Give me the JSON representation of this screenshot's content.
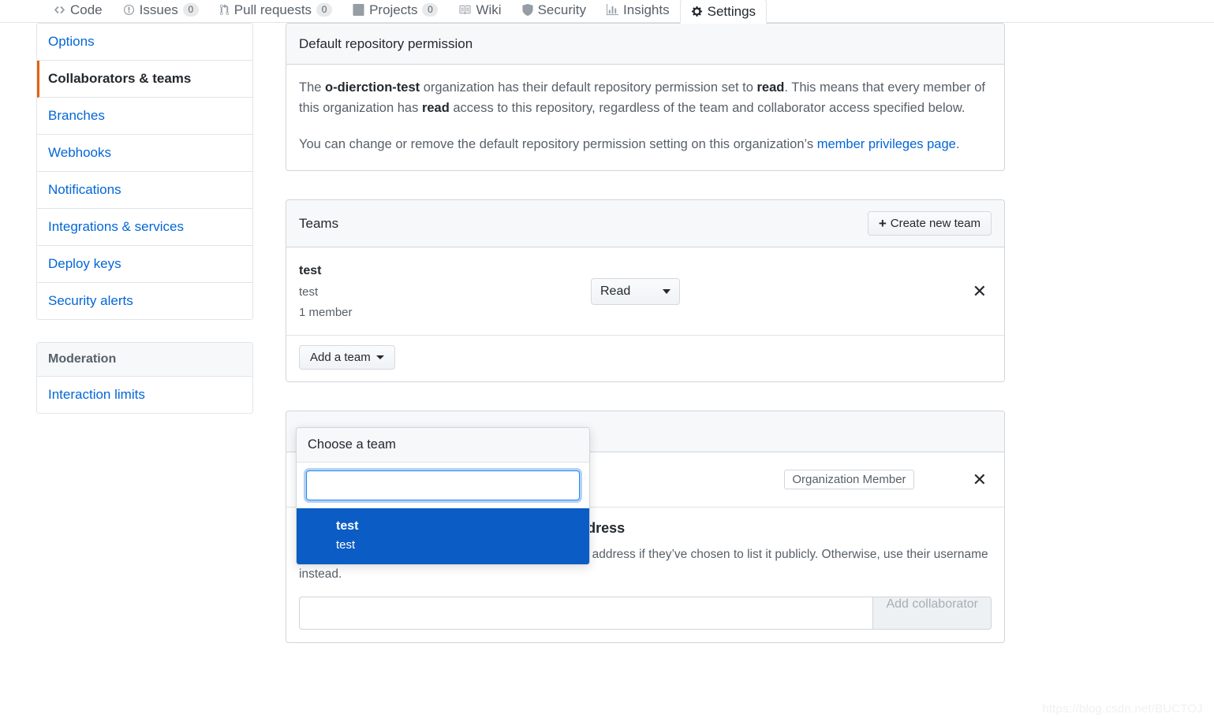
{
  "repo_nav": {
    "items": [
      {
        "label": "Code",
        "icon": "code-icon",
        "count": null,
        "active": false
      },
      {
        "label": "Issues",
        "icon": "issue-opened-icon",
        "count": "0",
        "active": false
      },
      {
        "label": "Pull requests",
        "icon": "git-pull-request-icon",
        "count": "0",
        "active": false
      },
      {
        "label": "Projects",
        "icon": "project-icon",
        "count": "0",
        "active": false
      },
      {
        "label": "Wiki",
        "icon": "book-icon",
        "count": null,
        "active": false
      },
      {
        "label": "Security",
        "icon": "shield-icon",
        "count": null,
        "active": false
      },
      {
        "label": "Insights",
        "icon": "graph-icon",
        "count": null,
        "active": false
      },
      {
        "label": "Settings",
        "icon": "gear-icon",
        "count": null,
        "active": true
      }
    ]
  },
  "sidebar": {
    "items": [
      {
        "label": "Options",
        "selected": false
      },
      {
        "label": "Collaborators & teams",
        "selected": true
      },
      {
        "label": "Branches",
        "selected": false
      },
      {
        "label": "Webhooks",
        "selected": false
      },
      {
        "label": "Notifications",
        "selected": false
      },
      {
        "label": "Integrations & services",
        "selected": false
      },
      {
        "label": "Deploy keys",
        "selected": false
      },
      {
        "label": "Security alerts",
        "selected": false
      }
    ],
    "moderation": {
      "heading": "Moderation",
      "items": [
        {
          "label": "Interaction limits",
          "selected": false
        }
      ]
    }
  },
  "default_permission": {
    "title": "Default repository permission",
    "p1_a": "The ",
    "p1_org": "o-dierction-test",
    "p1_b": " organization has their default repository permission set to ",
    "p1_perm": "read",
    "p1_c": ". This means that every member of this organization has ",
    "p1_perm2": "read",
    "p1_d": " access to this repository, regardless of the team and collaborator access specified below.",
    "p2_a": "You can change or remove the default repository permission setting on this organization’s ",
    "p2_link": "member privileges page",
    "p2_b": "."
  },
  "teams": {
    "title": "Teams",
    "create_button": "Create new team",
    "create_button_icon": "plus-icon",
    "rows": [
      {
        "name": "test",
        "description": "test",
        "members": "1 member",
        "permission": "Read",
        "remove_icon": "close-icon"
      }
    ],
    "add_team_button": "Add a team"
  },
  "team_dropdown": {
    "header": "Choose a team",
    "filter_value": "",
    "filter_placeholder": "",
    "options": [
      {
        "name": "test",
        "description": "test",
        "selected": true
      }
    ]
  },
  "collaborators": {
    "rows": [
      {
        "badge": "Organization Member",
        "remove_icon": "close-icon"
      }
    ],
    "search_title": "Search by username, full name or email address",
    "search_note": "You’ll only be able to find a GitHub user by their email address if they’ve chosen to list it publicly. Otherwise, use their username instead.",
    "search_value": "",
    "search_placeholder": "",
    "add_button": "Add collaborator"
  },
  "watermark": "https://blog.csdn.net/BUCTOJ",
  "colors": {
    "accent_blue": "#0366d6",
    "selected_blue": "#0b5cc4",
    "active_orange": "#e36209",
    "border": "#d1d5da",
    "header_bg": "#f6f8fa"
  }
}
